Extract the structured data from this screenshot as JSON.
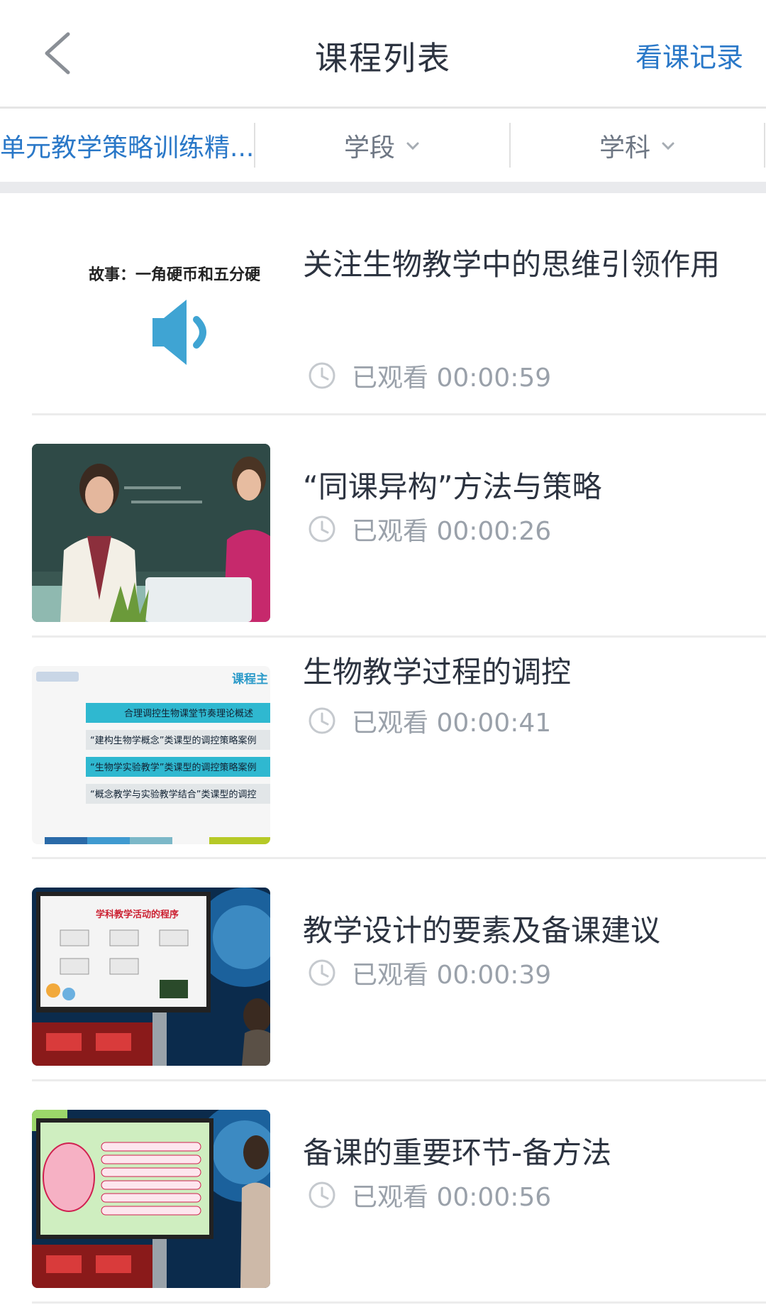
{
  "header": {
    "title": "课程列表",
    "record_link": "看课记录"
  },
  "filters": [
    {
      "label": "单元教学策略训练精..."
    },
    {
      "label": "学段"
    },
    {
      "label": "学科"
    }
  ],
  "courses": [
    {
      "title": "关注生物教学中的思维引领作用",
      "watched": "已观看 00:00:59",
      "thumb_caption": "故事：一角硬币和五分硬"
    },
    {
      "title": "“同课异构”方法与策略",
      "watched": "已观看 00:00:26"
    },
    {
      "title": "生物教学过程的调控",
      "watched": "已观看 00:00:41",
      "thumb_caption": "课程主",
      "thumb_lines": [
        "合理调控生物课堂节奏理论概述",
        "“建构生物学概念”类课型的调控策略案例",
        "“生物学实验教学”类课型的调控策略案例",
        "“概念教学与实验教学结合”类课型的调控"
      ]
    },
    {
      "title": "教学设计的要素及备课建议",
      "watched": "已观看 00:00:39",
      "thumb_caption": "学科教学活动的程序"
    },
    {
      "title": "备课的重要环节-备方法",
      "watched": "已观看 00:00:56"
    }
  ],
  "colors": {
    "accent": "#2a78c8",
    "title_text": "#2c3340",
    "meta_text": "#9aa1aa"
  }
}
